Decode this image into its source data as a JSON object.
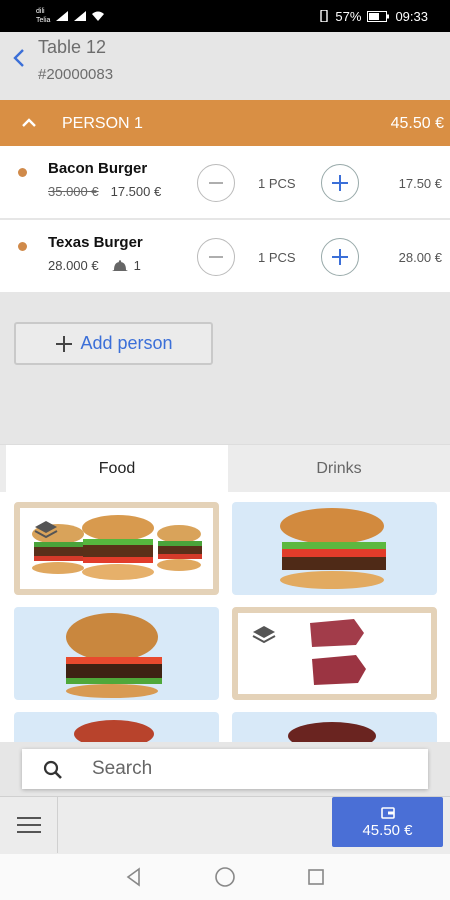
{
  "status_bar": {
    "carrier_1": "dili",
    "carrier_2": "Telia",
    "battery": "57%",
    "time": "09:33"
  },
  "header": {
    "title": "Table 12",
    "order_number": "#20000083"
  },
  "person": {
    "name": "PERSON 1",
    "total": "45.50 €"
  },
  "items": [
    {
      "name": "Bacon Burger",
      "old_price": "35.000 €",
      "price": "17.500 €",
      "qty": "1 PCS",
      "total": "17.50 €"
    },
    {
      "name": "Texas Burger",
      "price": "28.000 €",
      "cloche_count": "1",
      "qty": "1 PCS",
      "total": "28.00 €"
    }
  ],
  "add_person_label": "Add person",
  "tabs": [
    "Food",
    "Drinks"
  ],
  "search": {
    "placeholder": "Search"
  },
  "pay": {
    "total": "45.50 €"
  },
  "colors": {
    "accent": "#d98f44",
    "primary": "#4a6fd6",
    "link": "#3b6fd8"
  }
}
